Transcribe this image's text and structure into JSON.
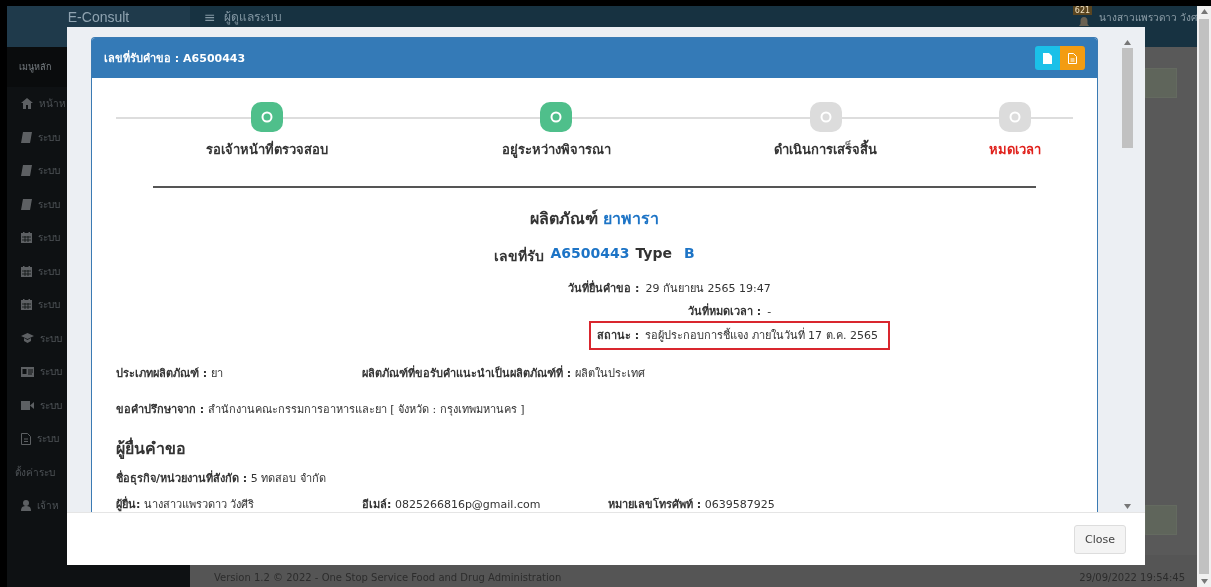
{
  "header": {
    "logo": "E-Consult",
    "menu_icon": "≡",
    "title": "ผู้ดูแลระบบ",
    "notification_count": "621",
    "user": "นางสาวแพรวดาว วังศ"
  },
  "sidebar": {
    "heading": "เมนูหลัก",
    "items": [
      {
        "kind": "home",
        "label": "หน้าห"
      },
      {
        "kind": "book",
        "label": "ระบบ"
      },
      {
        "kind": "book",
        "label": "ระบบ"
      },
      {
        "kind": "book",
        "label": "ระบบ"
      },
      {
        "kind": "calendar",
        "label": "ระบบ"
      },
      {
        "kind": "calendar",
        "label": "ระบบ"
      },
      {
        "kind": "calendar",
        "label": "ระบบ"
      },
      {
        "kind": "cap",
        "label": "ระบบ"
      },
      {
        "kind": "card",
        "label": "ระบบ"
      },
      {
        "kind": "video",
        "label": "ระบบ"
      },
      {
        "kind": "file",
        "label": "ระบบ"
      },
      {
        "kind": "section",
        "label": "ตั้งค่าระบ"
      },
      {
        "kind": "user",
        "label": "เจ้าห"
      }
    ]
  },
  "footer": {
    "version": "Version 1.2 © 2022 - One Stop Service Food and Drug Administration",
    "timestamp": "29/09/2022 19:54:45"
  },
  "modal": {
    "title": "เลขที่รับคำขอ : A6500443",
    "steps": [
      {
        "label": "รอเจ้าหน้าที่ตรวจสอบ",
        "done": true,
        "alert": false
      },
      {
        "label": "อยู่ระหว่างพิจารณา",
        "done": true,
        "alert": false
      },
      {
        "label": "ดำเนินการเสร็จสิ้น",
        "done": false,
        "alert": false
      },
      {
        "label": "หมดเวลา",
        "done": false,
        "alert": true
      }
    ],
    "product_label": "ผลิตภัณฑ์",
    "product_name": "ยาพารา",
    "receipt_label": "เลขที่รับ",
    "receipt_no": "A6500443",
    "type_label": "Type",
    "type_value": "B",
    "dates": [
      {
        "label": "วันที่ยื่นคำขอ :",
        "value": "29 กันยายน 2565 19:47",
        "highlighted": false
      },
      {
        "label": "วันที่หมดเวลา :",
        "value": "-",
        "highlighted": false
      },
      {
        "label": "สถานะ :",
        "value": "รอผู้ประกอบการชี้แจง ภายในวันที่ 17 ต.ค. 2565",
        "highlighted": true
      }
    ],
    "product_fields": [
      {
        "label": "ประเภทผลิตภัณฑ์ :",
        "value": "ยา"
      },
      {
        "label": "ผลิตภัณฑ์ที่ขอรับคำแนะนำเป็นผลิตภัณฑ์ที่ :",
        "value": "ผลิตในประเทศ"
      }
    ],
    "consult_from": {
      "label": "ขอคำปรึกษาจาก :",
      "value": "สำนักงานคณะกรรมการอาหารและยา [ จังหวัด : กรุงเทพมหานคร ]"
    },
    "applicant_heading": "ผู้ยื่นคำขอ",
    "business": {
      "label": "ชื่อธุรกิจ/หน่วยงานที่สังกัด :",
      "value": "5 ทดสอบ จำกัด"
    },
    "applicant_fields": [
      {
        "label": "ผู้ยื่น:",
        "value": "นางสาวแพรวดาว วังศีริ"
      },
      {
        "label": "อีเมล์:",
        "value": "0825266816p@gmail.com"
      },
      {
        "label": "หมายเลขโทรศัพท์ :",
        "value": "0639587925"
      }
    ],
    "close_button": "Close"
  }
}
